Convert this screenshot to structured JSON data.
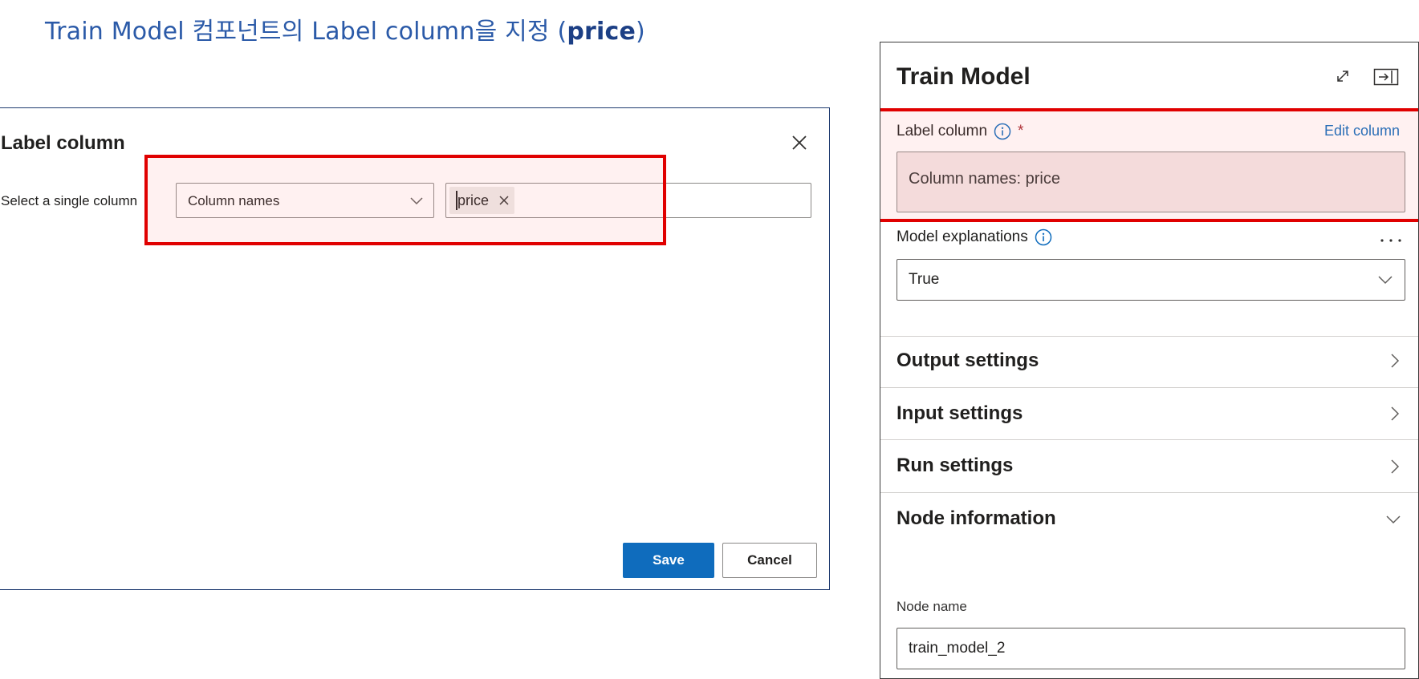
{
  "heading": {
    "main": "Train Model 컴포넌트의 Label column을 지정 (",
    "bold": "price",
    "end": ")"
  },
  "dialog": {
    "title": "Label column",
    "select_label": "Select a single column",
    "select_value": "Column names",
    "tag_value": "price",
    "save_label": "Save",
    "cancel_label": "Cancel"
  },
  "panel": {
    "title": "Train Model",
    "label_column": {
      "label": "Label column",
      "required_mark": "*",
      "edit_link": "Edit column",
      "value": "Column names: price"
    },
    "model_explanations": {
      "label": "Model explanations",
      "value": "True"
    },
    "sections": [
      {
        "label": "Output settings",
        "state": "collapsed"
      },
      {
        "label": "Input settings",
        "state": "collapsed"
      },
      {
        "label": "Run settings",
        "state": "collapsed"
      },
      {
        "label": "Node information",
        "state": "expanded"
      }
    ],
    "node_name": {
      "label": "Node name",
      "value": "train_model_2"
    }
  },
  "colors": {
    "accent": "#0f6cbd",
    "highlight": "#e00000",
    "heading": "#2b5aa8"
  }
}
